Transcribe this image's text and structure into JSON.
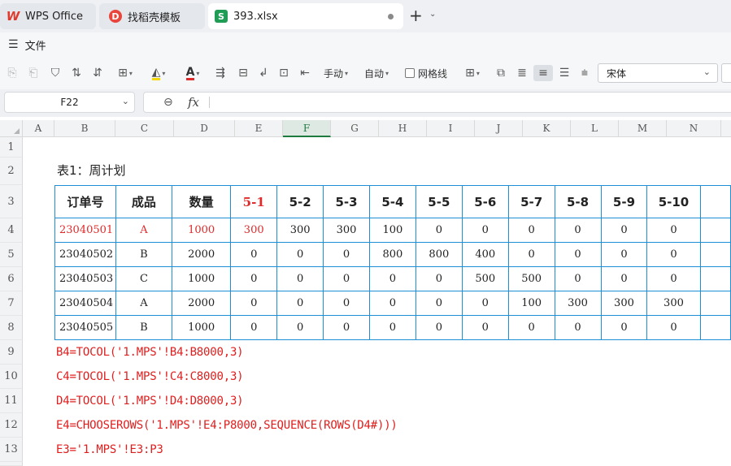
{
  "tabs": [
    {
      "label": "WPS Office"
    },
    {
      "label": "找稻壳模板"
    },
    {
      "label": "393.xlsx"
    }
  ],
  "menu": {
    "file": "文件"
  },
  "toolbar": {
    "manual": "手动",
    "auto": "自动",
    "gridlines": "网格线",
    "font": "宋体"
  },
  "formula_bar": {
    "cell_ref": "F22",
    "fx": "fx",
    "content": ""
  },
  "columns": [
    "A",
    "B",
    "C",
    "D",
    "E",
    "F",
    "G",
    "H",
    "I",
    "J",
    "K",
    "L",
    "M",
    "N"
  ],
  "selected_column": "F",
  "rows": [
    "1",
    "2",
    "3",
    "4",
    "5",
    "6",
    "7",
    "8",
    "9",
    "10",
    "11",
    "12",
    "13"
  ],
  "sheet": {
    "title": "表1：周计划",
    "table_header": [
      "订单号",
      "成品",
      "数量",
      "5-1",
      "5-2",
      "5-3",
      "5-4",
      "5-5",
      "5-6",
      "5-7",
      "5-8",
      "5-9",
      "5-10"
    ],
    "table_rows": [
      [
        "23040501",
        "A",
        "1000",
        "300",
        "300",
        "300",
        "100",
        "0",
        "0",
        "0",
        "0",
        "0",
        "0"
      ],
      [
        "23040502",
        "B",
        "2000",
        "0",
        "0",
        "0",
        "800",
        "800",
        "400",
        "0",
        "0",
        "0",
        "0"
      ],
      [
        "23040503",
        "C",
        "1000",
        "0",
        "0",
        "0",
        "0",
        "0",
        "500",
        "500",
        "0",
        "0",
        "0"
      ],
      [
        "23040504",
        "A",
        "2000",
        "0",
        "0",
        "0",
        "0",
        "0",
        "0",
        "100",
        "300",
        "300",
        "300"
      ],
      [
        "23040505",
        "B",
        "1000",
        "0",
        "0",
        "0",
        "0",
        "0",
        "0",
        "0",
        "0",
        "0",
        "0"
      ]
    ],
    "formulas": [
      "B4=TOCOL('1.MPS'!B4:B8000,3)",
      "C4=TOCOL('1.MPS'!C4:C8000,3)",
      "D4=TOCOL('1.MPS'!D4:D8000,3)",
      "E4=CHOOSEROWS('1.MPS'!E4:P8000,SEQUENCE(ROWS(D4#)))",
      "E3='1.MPS'!E3:P3"
    ]
  },
  "colors": {
    "accent_red": "#e02a2a",
    "table_border": "#1c8fd6",
    "selected_col": "#1f7a3f"
  }
}
